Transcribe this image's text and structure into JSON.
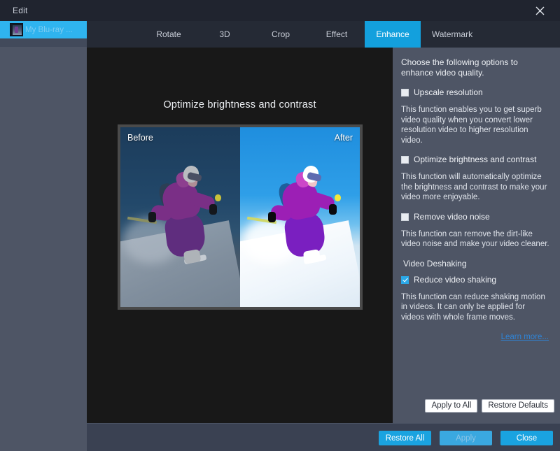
{
  "titlebar": {
    "title": "Edit",
    "close_icon": "close-icon"
  },
  "sidebar": {
    "items": [
      {
        "label": "My Blu-ray ...",
        "thumb_icon": "video-thumbnail-icon"
      }
    ]
  },
  "tabs": [
    {
      "label": "Rotate",
      "active": false
    },
    {
      "label": "3D",
      "active": false
    },
    {
      "label": "Crop",
      "active": false
    },
    {
      "label": "Effect",
      "active": false
    },
    {
      "label": "Enhance",
      "active": true
    },
    {
      "label": "Watermark",
      "active": false
    }
  ],
  "preview": {
    "title": "Optimize brightness and contrast",
    "before_label": "Before",
    "after_label": "After"
  },
  "options": {
    "intro": "Choose the following options to enhance video quality.",
    "items": [
      {
        "label": "Upscale resolution",
        "checked": false,
        "description": "This function enables you to get superb video quality when you convert lower resolution video to higher resolution video."
      },
      {
        "label": "Optimize brightness and contrast",
        "checked": false,
        "description": "This function will automatically optimize the brightness and contrast to make your video more enjoyable."
      },
      {
        "label": "Remove video noise",
        "checked": false,
        "description": "This function can remove the dirt-like video noise and make your video cleaner."
      }
    ],
    "group_label": "Video Deshaking",
    "deshake": {
      "label": "Reduce video shaking",
      "checked": true,
      "description": "This function can reduce shaking motion in videos. It can only be applied for videos with whole frame moves."
    },
    "learn_more": "Learn more...",
    "apply_to_all_label": "Apply to All",
    "restore_defaults_label": "Restore Defaults"
  },
  "bottom": {
    "restore_all_label": "Restore All",
    "apply_label": "Apply",
    "close_label": "Close"
  },
  "colors": {
    "accent": "#13a0dd",
    "panel": "#4e5565",
    "titlebar": "#20242f",
    "preview_bg": "#181818",
    "bottombar": "#3a4152",
    "link": "#2f84d6"
  }
}
